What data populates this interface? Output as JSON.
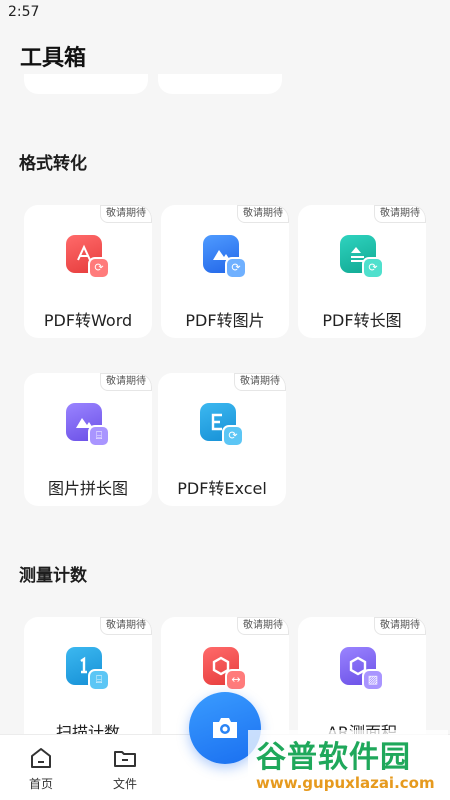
{
  "status": {
    "time": "2:57"
  },
  "page": {
    "title": "工具箱"
  },
  "sections": [
    {
      "title": "格式转化",
      "tools": [
        {
          "label": "PDF转Word",
          "badge": "敬请期待",
          "icon": "pdf-to-word-icon",
          "color": "#f04e4e"
        },
        {
          "label": "PDF转图片",
          "badge": "敬请期待",
          "icon": "pdf-to-image-icon",
          "color": "#2f7cf6"
        },
        {
          "label": "PDF转长图",
          "badge": "敬请期待",
          "icon": "pdf-to-long-image-icon",
          "color": "#16b9a6"
        },
        {
          "label": "图片拼长图",
          "badge": "敬请期待",
          "icon": "image-stitch-icon",
          "color": "#7c63f0"
        },
        {
          "label": "PDF转Excel",
          "badge": "敬请期待",
          "icon": "pdf-to-excel-icon",
          "color": "#1a9fe0"
        }
      ]
    },
    {
      "title": "测量计数",
      "tools": [
        {
          "label": "扫描计数",
          "badge": "敬请期待",
          "icon": "scan-count-icon",
          "color": "#1a9fe0"
        },
        {
          "label": "",
          "badge": "敬请期待",
          "icon": "measure-icon",
          "color": "#f04e4e"
        },
        {
          "label": "AR测面积",
          "badge": "敬请期待",
          "icon": "ar-area-icon",
          "color": "#7c63f0"
        }
      ]
    }
  ],
  "bottom_nav": {
    "home": "首页",
    "files": "文件"
  },
  "watermark": {
    "name": "谷普软件园",
    "url": "www.gupuxlazai.com"
  }
}
